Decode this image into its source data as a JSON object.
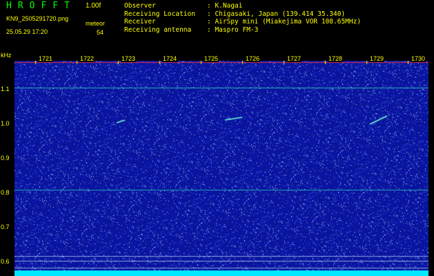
{
  "app": {
    "title": "HROFFT",
    "version": "1.00f"
  },
  "file": {
    "name": "KN9_2505291720.png",
    "datetime": "25.05.29 17:20"
  },
  "meteor": {
    "label": "meteor",
    "count": "54"
  },
  "info": [
    {
      "key": "Observer",
      "value": ": K.Nagai"
    },
    {
      "key": "Receiving Location",
      "value": ": Chigasaki, Japan (139.414 35.340)"
    },
    {
      "key": "Receiver",
      "value": ": AirSpy mini (Miakejima VOR 108.65MHz)"
    },
    {
      "key": "Receiving antenna",
      "value": ": Maspro FM-3"
    }
  ],
  "axis": {
    "unit": "kHz",
    "y_ticks": [
      "1.1",
      "1.0",
      "0.9",
      "0.8",
      "0.7",
      "0.6"
    ],
    "time_ticks": [
      "1721",
      "1722",
      "1723",
      "1724",
      "1725",
      "1726",
      "1727",
      "1728",
      "1729",
      "1730"
    ]
  },
  "colors": {
    "label": "#ffff00",
    "title": "#00ff00",
    "background": "#000000",
    "noise_base": "#0a1aa0"
  }
}
